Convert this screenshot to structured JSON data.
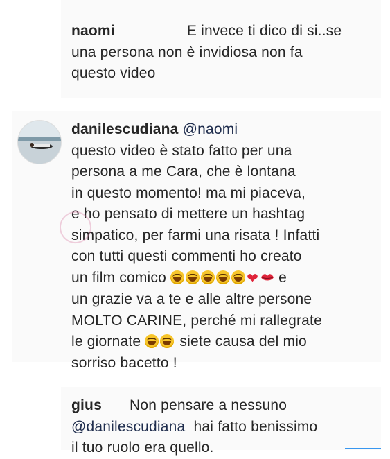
{
  "comments": [
    {
      "user": "naomi",
      "line1": "E invece ti dico di si..se",
      "line2": "una persona non è invidiosa non fa",
      "line3": "questo video"
    },
    {
      "user": "danilescudiana",
      "mention": "@naomi",
      "lines": [
        "questo video è stato fatto per una",
        "persona a me Cara, che è  lontana",
        "in questo momento! ma mi piaceva,",
        "e ho pensato di mettere un hashtag",
        "simpatico, per farmi una risata ! Infatti",
        "con tutti questi commenti ho creato",
        "un film comico",
        "e",
        "un grazie va a te e alle altre persone",
        "MOLTO CARINE, perché mi rallegrate",
        "le giornate",
        "siete causa del mio",
        "sorriso bacetto !"
      ]
    },
    {
      "user": "gius",
      "line1": "Non pensare a nessuno",
      "mention": "@danilescudiana",
      "line2": "hai fatto benissimo",
      "line3": "il tuo ruolo era quello."
    }
  ],
  "icons": {
    "laugh": "face-with-tears-of-joy-icon",
    "heart": "red-heart-icon",
    "kiss": "kiss-mark-icon"
  },
  "colors": {
    "panel": "#fafafa",
    "text": "#262626",
    "mention": "#1f2d4d",
    "heart": "#e0243a"
  }
}
